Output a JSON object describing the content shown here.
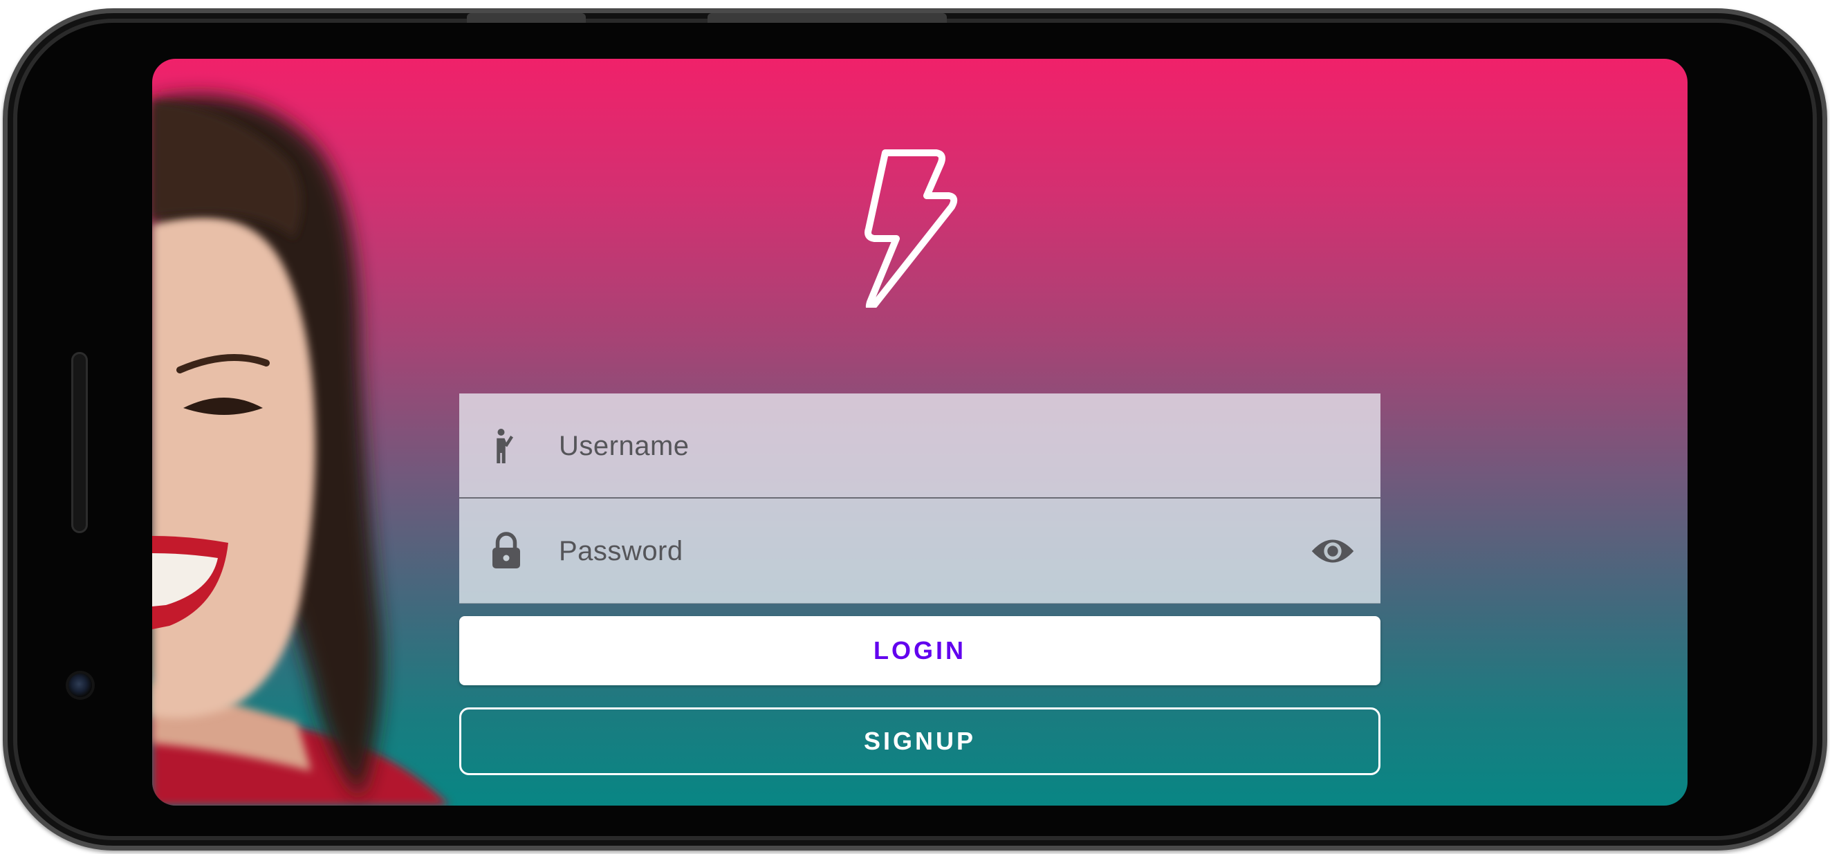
{
  "login_form": {
    "username": {
      "placeholder": "Username",
      "icon": "person-waving-icon"
    },
    "password": {
      "placeholder": "Password",
      "icon": "lock-icon",
      "toggle_icon": "eye-icon"
    },
    "login_label": "LOGIN",
    "signup_label": "SIGNUP"
  },
  "branding": {
    "logo": "lightning-bolt-icon"
  },
  "colors": {
    "gradient_top": "#f0216a",
    "gradient_bottom": "#088684",
    "login_text": "#6200ee",
    "signup_border": "#ffffff",
    "field_icon": "#555559"
  }
}
